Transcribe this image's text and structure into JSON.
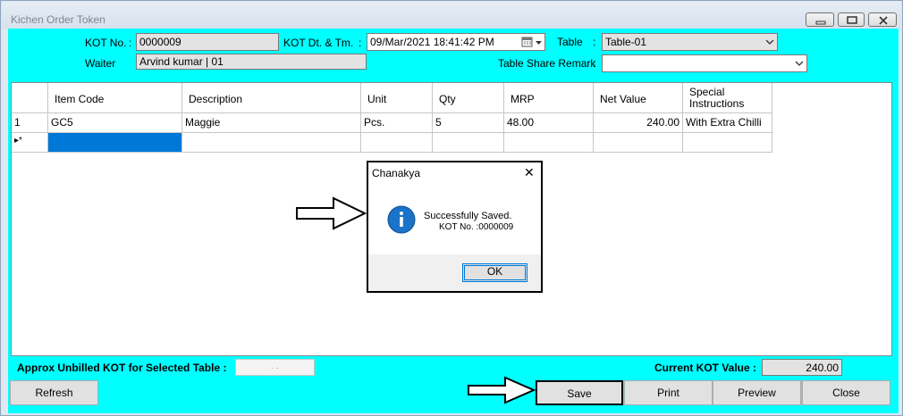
{
  "window": {
    "title": "Kichen Order Token"
  },
  "header": {
    "kot_no_label": "KOT No.",
    "kot_no_value": "0000009",
    "kot_dt_label": "KOT Dt. & Tm.",
    "kot_dt_value": "09/Mar/2021 18:41:42 PM",
    "table_label": "Table",
    "table_value": "Table-01",
    "waiter_label": "Waiter",
    "waiter_value": "Arvind kumar | 01",
    "share_remark_label": "Table Share Remark",
    "share_remark_value": "",
    "colon": ":"
  },
  "grid": {
    "columns": [
      "Item Code",
      "Description",
      "Unit",
      "Qty",
      "MRP",
      "Net Value",
      "Special Instructions"
    ],
    "rows": [
      {
        "index": "1",
        "item_code": "GC5",
        "description": "Maggie",
        "unit": "Pcs.",
        "qty": "5",
        "mrp": "48.00",
        "net_value": "240.00",
        "special": "With Extra Chilli"
      }
    ],
    "new_row_marker": "▸*"
  },
  "dialog": {
    "title": "Chanakya",
    "message": "Successfully Saved.",
    "detail": "KOT No. :0000009",
    "ok_label": "OK",
    "close_glyph": "✕",
    "info_glyph": "i"
  },
  "footer": {
    "unbilled_label": "Approx Unbilled KOT for Selected Table :",
    "unbilled_value": ". .",
    "current_kot_label": "Current KOT Value :",
    "current_kot_value": "240.00",
    "refresh_label": "Refresh",
    "save_label": "Save",
    "print_label": "Print",
    "preview_label": "Preview",
    "close_label": "Close"
  },
  "colors": {
    "client_bg": "#00ffff",
    "selected_cell": "#0078d7",
    "info_icon": "#1a73c8"
  },
  "icons": [
    "minimize-icon",
    "maximize-icon",
    "close-icon",
    "calendar-icon",
    "chevron-down-icon",
    "info-icon",
    "arrow-pointer-icon"
  ]
}
